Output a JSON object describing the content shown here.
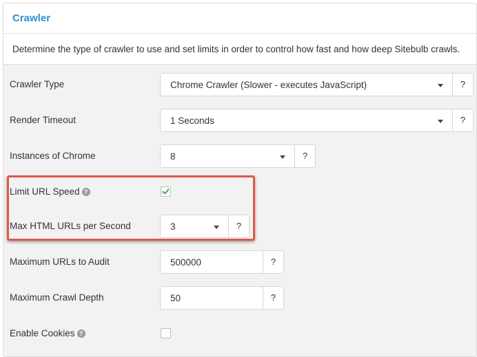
{
  "panel": {
    "title": "Crawler",
    "description": "Determine the type of crawler to use and set limits in order to control how fast and how deep Sitebulb crawls."
  },
  "help_button_label": "?",
  "help_icon_glyph": "?",
  "settings": {
    "crawler_type": {
      "label": "Crawler Type",
      "value": "Chrome Crawler (Slower - executes JavaScript)"
    },
    "render_timeout": {
      "label": "Render Timeout",
      "value": "1 Seconds"
    },
    "instances_of_chrome": {
      "label": "Instances of Chrome",
      "value": "8"
    },
    "limit_url_speed": {
      "label": "Limit URL Speed",
      "checked": true
    },
    "max_html_urls_per_second": {
      "label": "Max HTML URLs per Second",
      "value": "3"
    },
    "maximum_urls_to_audit": {
      "label": "Maximum URLs to Audit",
      "value": "500000"
    },
    "maximum_crawl_depth": {
      "label": "Maximum Crawl Depth",
      "value": "50"
    },
    "enable_cookies": {
      "label": "Enable Cookies",
      "checked": false
    }
  },
  "colors": {
    "accent": "#2f8fd0",
    "highlight_border": "#e0574a",
    "checkmark": "#4caf50"
  }
}
